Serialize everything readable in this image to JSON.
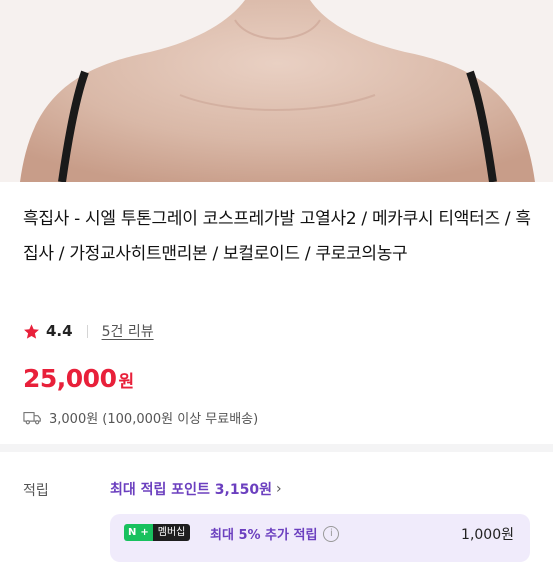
{
  "product": {
    "title": "흑집사 - 시엘 투톤그레이 코스프레가발 고열사2 / 메카쿠시 티액터즈 / 흑집사 / 가정교사히트맨리본 / 보컬로이드 / 쿠로코의농구"
  },
  "rating": {
    "score": "4.4",
    "reviews_label": "5건 리뷰",
    "star_color": "#e8203a"
  },
  "price": {
    "amount": "25,000",
    "unit": "원",
    "color": "#e8203a"
  },
  "shipping": {
    "text": "3,000원 (100,000원 이상 무료배송)",
    "icon": "truck-icon"
  },
  "points": {
    "label": "적립",
    "max_text": "최대 적립 포인트 3,150원",
    "member": {
      "badge_n": "N",
      "badge_plus": "+",
      "badge_text": "멤버십",
      "text": "최대 5% 추가 적립",
      "amount": "1,000원"
    }
  }
}
